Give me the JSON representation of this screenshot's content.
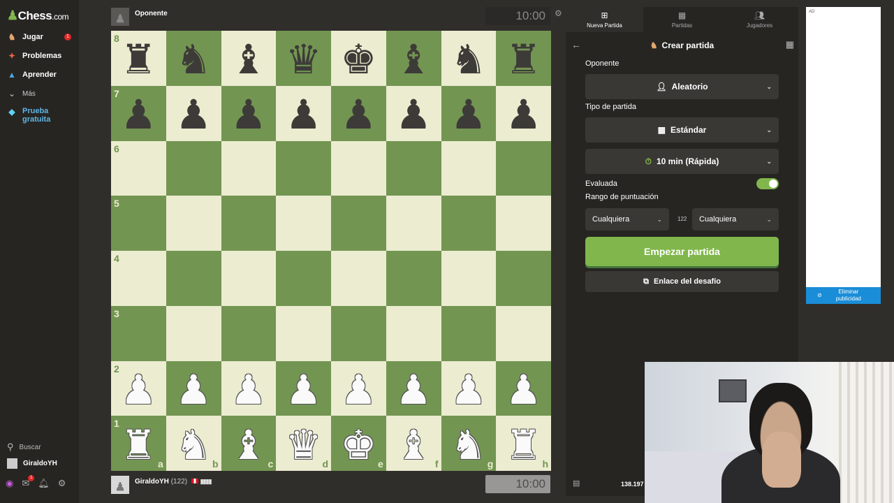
{
  "sidebar": {
    "logo_main": "Chess",
    "logo_suffix": ".com",
    "items": [
      {
        "label": "Jugar",
        "icon": "play-icon",
        "badge": "1"
      },
      {
        "label": "Problemas",
        "icon": "puzzle-icon"
      },
      {
        "label": "Aprender",
        "icon": "learn-icon"
      },
      {
        "label": "Más",
        "icon": "chevron-down-icon"
      }
    ],
    "trial_line1": "Prueba",
    "trial_line2": "gratuita",
    "search_label": "Buscar",
    "username": "GiraldoYH",
    "mail_badge": "1"
  },
  "game": {
    "opponent": {
      "name": "Oponente",
      "clock": "10:00"
    },
    "player": {
      "name": "GiraldoYH",
      "rating": "(122)",
      "clock": "10:00"
    },
    "ranks": [
      "8",
      "7",
      "6",
      "5",
      "4",
      "3",
      "2",
      "1"
    ],
    "files": [
      "a",
      "b",
      "c",
      "d",
      "e",
      "f",
      "g",
      "h"
    ],
    "position": [
      [
        "r",
        "n",
        "b",
        "q",
        "k",
        "b",
        "n",
        "r"
      ],
      [
        "p",
        "p",
        "p",
        "p",
        "p",
        "p",
        "p",
        "p"
      ],
      [
        "",
        "",
        "",
        "",
        "",
        "",
        "",
        ""
      ],
      [
        "",
        "",
        "",
        "",
        "",
        "",
        "",
        ""
      ],
      [
        "",
        "",
        "",
        "",
        "",
        "",
        "",
        ""
      ],
      [
        "",
        "",
        "",
        "",
        "",
        "",
        "",
        ""
      ],
      [
        "P",
        "P",
        "P",
        "P",
        "P",
        "P",
        "P",
        "P"
      ],
      [
        "R",
        "N",
        "B",
        "Q",
        "K",
        "B",
        "N",
        "R"
      ]
    ]
  },
  "panel": {
    "tabs": [
      {
        "label": "Nueva Partida",
        "icon": "plus-icon",
        "active": true
      },
      {
        "label": "Partidas",
        "icon": "board-icon",
        "active": false
      },
      {
        "label": "Jugadores",
        "icon": "players-icon",
        "active": false
      }
    ],
    "title": "Crear partida",
    "opponent_label": "Oponente",
    "opponent_value": "Aleatorio",
    "game_type_label": "Tipo de partida",
    "game_type_value": "Estándar",
    "time_control_value": "10 min (Rápida)",
    "rated_label": "Evaluada",
    "rated": true,
    "rating_range_label": "Rango de puntuación",
    "range_min": "Cualquiera",
    "range_mid": "122",
    "range_max": "Cualquiera",
    "start_button": "Empezar partida",
    "challenge_link_button": "Enlace del desafío",
    "online_count": "138.197"
  },
  "ad": {
    "tag": "AD",
    "remove_label": "Eliminar publicidad"
  },
  "colors": {
    "board_light": "#ebecd0",
    "board_dark": "#739552",
    "accent_green": "#81b64c",
    "ad_blue": "#1a8dd8"
  }
}
